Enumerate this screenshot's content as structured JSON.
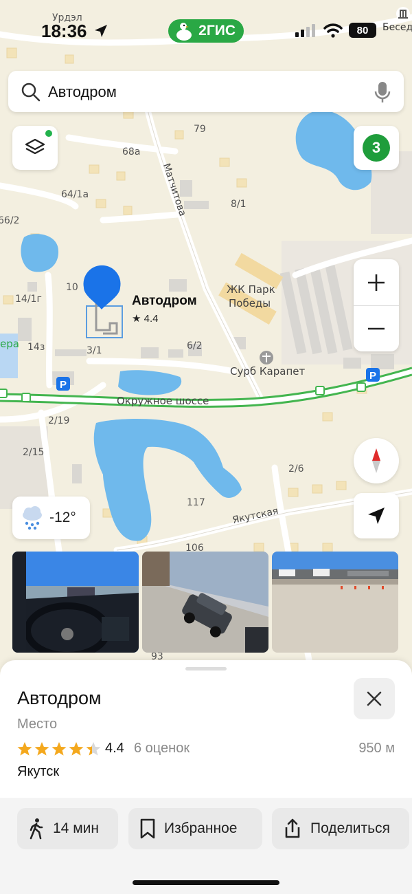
{
  "status_bar": {
    "time": "18:36",
    "brand": "2ГИС",
    "battery": "80"
  },
  "search": {
    "query": "Автодром"
  },
  "map": {
    "zone_badge": "3",
    "weather": {
      "icon": "snow-cloud-icon",
      "temperature": "-12°"
    },
    "pin": {
      "name": "Автодром",
      "rating": "★ 4.4"
    },
    "labels": [
      {
        "name": "label-urdel",
        "text": "Урдэл"
      },
      {
        "name": "label-beseda",
        "text": "Бесед"
      },
      {
        "name": "label-79",
        "text": "79"
      },
      {
        "name": "label-68a",
        "text": "68а"
      },
      {
        "name": "label-64-1a",
        "text": "64/1а"
      },
      {
        "name": "label-66-2",
        "text": "66/2"
      },
      {
        "name": "label-8-1",
        "text": "8/1"
      },
      {
        "name": "label-10",
        "text": "10"
      },
      {
        "name": "label-14-1g",
        "text": "14/1г"
      },
      {
        "name": "label-zhk-1",
        "text": "ЖК Парк"
      },
      {
        "name": "label-zhk-2",
        "text": "Победы"
      },
      {
        "name": "label-era",
        "text": "ера"
      },
      {
        "name": "label-14z",
        "text": "14з"
      },
      {
        "name": "label-3-1",
        "text": "3/1"
      },
      {
        "name": "label-6-2",
        "text": "6/2"
      },
      {
        "name": "label-church",
        "text": "Сурб Карапет"
      },
      {
        "name": "label-okruzhnoe",
        "text": "Окружное шоссе"
      },
      {
        "name": "label-2-19",
        "text": "2/19"
      },
      {
        "name": "label-2-15",
        "text": "2/15"
      },
      {
        "name": "label-2-6",
        "text": "2/6"
      },
      {
        "name": "label-117",
        "text": "117"
      },
      {
        "name": "label-yakutskaya",
        "text": "Якутская"
      },
      {
        "name": "label-106",
        "text": "106"
      },
      {
        "name": "label-93",
        "text": "93"
      },
      {
        "name": "label-matchitova",
        "text": "Матчитова"
      }
    ]
  },
  "place": {
    "title": "Автодром",
    "category": "Место",
    "rating": "4.4",
    "stars": 4.4,
    "reviews": "6 оценок",
    "distance": "950 м",
    "city": "Якутск"
  },
  "actions": [
    {
      "icon": "walking-person-icon",
      "label": "14 мин"
    },
    {
      "icon": "bookmark-icon",
      "label": "Избранное"
    },
    {
      "icon": "share-icon",
      "label": "Поделиться"
    }
  ],
  "colors": {
    "brand": "#2aa845",
    "water": "#6fb9ec",
    "route": "#43b54f",
    "pin": "#1a73e8",
    "star": "#f4a81d"
  }
}
